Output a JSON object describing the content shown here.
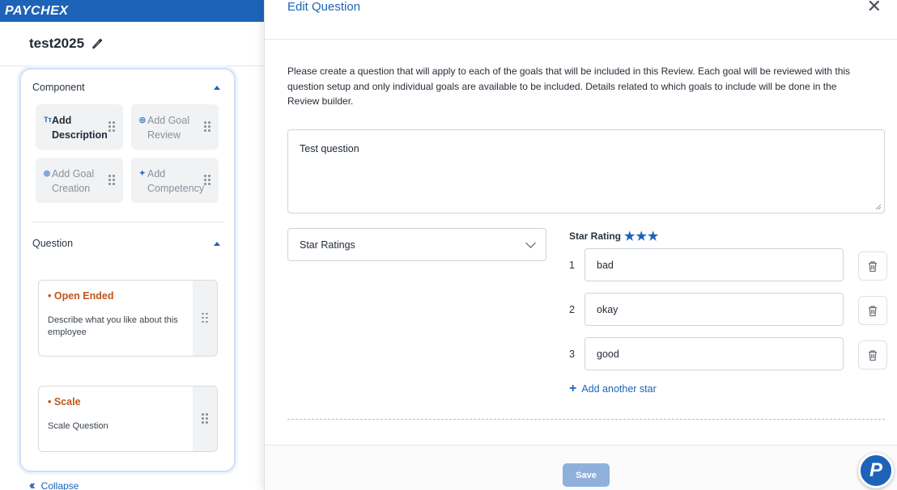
{
  "brand": {
    "name": "PAYCHEX",
    "color": "#1d63b8"
  },
  "document": {
    "title": "test2025",
    "edit_icon": "pencil-icon"
  },
  "builder": {
    "component_section": {
      "title": "Component",
      "items": [
        {
          "icon": "text-format-icon",
          "icon_glyph": "Tт",
          "label": "Add Description",
          "active": true
        },
        {
          "icon": "target-icon",
          "icon_glyph": "◎",
          "label": "Add Goal Review",
          "active": false
        },
        {
          "icon": "target-icon",
          "icon_glyph": "◎",
          "label": "Add Goal Creation",
          "active": false
        },
        {
          "icon": "sparkle-icon",
          "icon_glyph": "✦",
          "label": "Add Competency",
          "active": false
        }
      ]
    },
    "question_section": {
      "title": "Question",
      "items": [
        {
          "title": "• Open Ended",
          "description": "Describe what you like about this employee"
        },
        {
          "title": "• Scale",
          "description": "Scale Question"
        }
      ]
    },
    "collapse_label": "Collapse"
  },
  "modal": {
    "title": "Edit Question",
    "intro": "Please create a question that will apply to each of the goals that will be included in this Review. Each goal will be reviewed with this question setup and only individual goals are available to be included. Details related to which goals to include will be done in the Review builder.",
    "question_text": "Test question",
    "question_type": "Star Ratings",
    "star_rating": {
      "label": "Star Rating",
      "stars": "★★★",
      "count": 3,
      "rows": [
        {
          "number": "1",
          "value": "bad"
        },
        {
          "number": "2",
          "value": "okay"
        },
        {
          "number": "3",
          "value": "good"
        }
      ],
      "add_label": "Add another star"
    },
    "save_label": "Save"
  },
  "help_fab": {
    "glyph": "P",
    "icon": "paychex-help-icon"
  },
  "colors": {
    "accent": "#1d63b8",
    "question_title": "#c0561b",
    "save_disabled": "#8fb0da"
  }
}
